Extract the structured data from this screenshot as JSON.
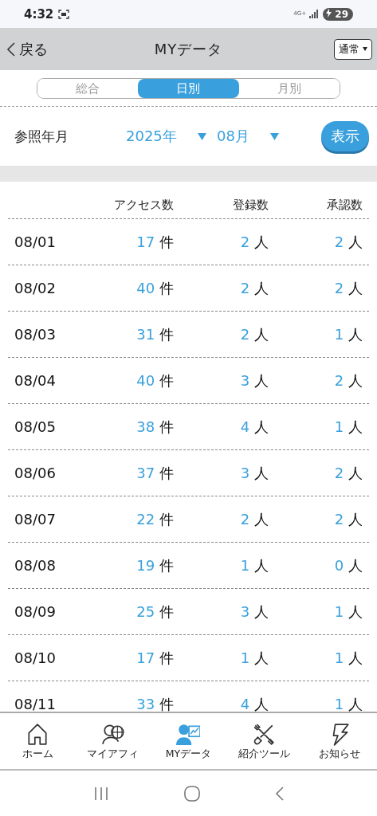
{
  "status_bar": {
    "time": "4:32",
    "network": "4G+",
    "battery": "29"
  },
  "header": {
    "back": "戻る",
    "title": "MYデータ",
    "mode": "通常"
  },
  "tabs": [
    {
      "label": "総合",
      "selected": false
    },
    {
      "label": "日別",
      "selected": true
    },
    {
      "label": "月別",
      "selected": false
    }
  ],
  "filter": {
    "label": "参照年月",
    "year": "2025年",
    "month": "08月",
    "button": "表示"
  },
  "table": {
    "columns": [
      "アクセス数",
      "登録数",
      "承認数"
    ],
    "rows": [
      {
        "date": "08/01",
        "cells": [
          {
            "value": "17",
            "unit": "件"
          },
          {
            "value": "2",
            "unit": "人"
          },
          {
            "value": "2",
            "unit": "人"
          }
        ]
      },
      {
        "date": "08/02",
        "cells": [
          {
            "value": "40",
            "unit": "件"
          },
          {
            "value": "2",
            "unit": "人"
          },
          {
            "value": "2",
            "unit": "人"
          }
        ]
      },
      {
        "date": "08/03",
        "cells": [
          {
            "value": "31",
            "unit": "件"
          },
          {
            "value": "2",
            "unit": "人"
          },
          {
            "value": "1",
            "unit": "人"
          }
        ]
      },
      {
        "date": "08/04",
        "cells": [
          {
            "value": "40",
            "unit": "件"
          },
          {
            "value": "3",
            "unit": "人"
          },
          {
            "value": "2",
            "unit": "人"
          }
        ]
      },
      {
        "date": "08/05",
        "cells": [
          {
            "value": "38",
            "unit": "件"
          },
          {
            "value": "4",
            "unit": "人"
          },
          {
            "value": "1",
            "unit": "人"
          }
        ]
      },
      {
        "date": "08/06",
        "cells": [
          {
            "value": "37",
            "unit": "件"
          },
          {
            "value": "3",
            "unit": "人"
          },
          {
            "value": "2",
            "unit": "人"
          }
        ]
      },
      {
        "date": "08/07",
        "cells": [
          {
            "value": "22",
            "unit": "件"
          },
          {
            "value": "2",
            "unit": "人"
          },
          {
            "value": "2",
            "unit": "人"
          }
        ]
      },
      {
        "date": "08/08",
        "cells": [
          {
            "value": "19",
            "unit": "件"
          },
          {
            "value": "1",
            "unit": "人"
          },
          {
            "value": "0",
            "unit": "人"
          }
        ]
      },
      {
        "date": "08/09",
        "cells": [
          {
            "value": "25",
            "unit": "件"
          },
          {
            "value": "3",
            "unit": "人"
          },
          {
            "value": "1",
            "unit": "人"
          }
        ]
      },
      {
        "date": "08/10",
        "cells": [
          {
            "value": "17",
            "unit": "件"
          },
          {
            "value": "1",
            "unit": "人"
          },
          {
            "value": "1",
            "unit": "人"
          }
        ]
      },
      {
        "date": "08/11",
        "cells": [
          {
            "value": "33",
            "unit": "件"
          },
          {
            "value": "4",
            "unit": "人"
          },
          {
            "value": "1",
            "unit": "人"
          }
        ]
      }
    ]
  },
  "bottom_nav": [
    {
      "label": "ホーム",
      "kind": "home",
      "selected": false
    },
    {
      "label": "マイアフィ",
      "kind": "globe",
      "selected": false
    },
    {
      "label": "MYデータ",
      "kind": "data",
      "selected": true
    },
    {
      "label": "紹介ツール",
      "kind": "tools",
      "selected": false
    },
    {
      "label": "お知らせ",
      "kind": "bolt",
      "selected": false
    }
  ]
}
